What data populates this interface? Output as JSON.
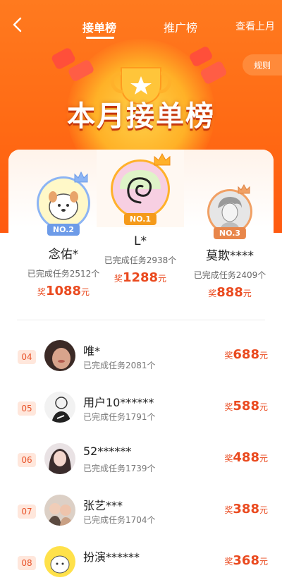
{
  "header": {
    "tabs": [
      {
        "label": "接单榜",
        "active": true
      },
      {
        "label": "推广榜",
        "active": false
      }
    ],
    "last_month_label": "查看上月",
    "rules_label": "规则",
    "board_title": "本月接单榜"
  },
  "colors": {
    "brand_orange": "#ff6a14",
    "reward_red": "#ea4a1f",
    "silver": "#8cb4f4",
    "gold": "#ffb12a",
    "bronze": "#f1a064"
  },
  "podium": [
    {
      "rank_label": "NO.2",
      "name": "念佑*",
      "done": "已完成任务2512个",
      "reward_prefix": "奖",
      "reward_value": "1088",
      "reward_unit": "元"
    },
    {
      "rank_label": "NO.1",
      "name": "L*",
      "done": "已完成任务2938个",
      "reward_prefix": "奖",
      "reward_value": "1288",
      "reward_unit": "元"
    },
    {
      "rank_label": "NO.3",
      "name": "莫欺****",
      "done": "已完成任务2409个",
      "reward_prefix": "奖",
      "reward_value": "888",
      "reward_unit": "元"
    }
  ],
  "list": [
    {
      "rank": "04",
      "name": "唯*",
      "done": "已完成任务2081个",
      "reward_prefix": "奖",
      "reward_value": "688",
      "reward_unit": "元",
      "avatar": "face-photo-icon"
    },
    {
      "rank": "05",
      "name": "用户10******",
      "done": "已完成任务1791个",
      "reward_prefix": "奖",
      "reward_value": "588",
      "reward_unit": "元",
      "avatar": "sketch-figure-icon"
    },
    {
      "rank": "06",
      "name": "52******",
      "done": "已完成任务1739个",
      "reward_prefix": "奖",
      "reward_value": "488",
      "reward_unit": "元",
      "avatar": "woman-photo-icon"
    },
    {
      "rank": "07",
      "name": "张艺***",
      "done": "已完成任务1704个",
      "reward_prefix": "奖",
      "reward_value": "388",
      "reward_unit": "元",
      "avatar": "kids-photo-icon"
    },
    {
      "rank": "08",
      "name": "扮演******",
      "done": "",
      "reward_prefix": "奖",
      "reward_value": "368",
      "reward_unit": "元",
      "avatar": "cartoon-dog-icon"
    }
  ]
}
